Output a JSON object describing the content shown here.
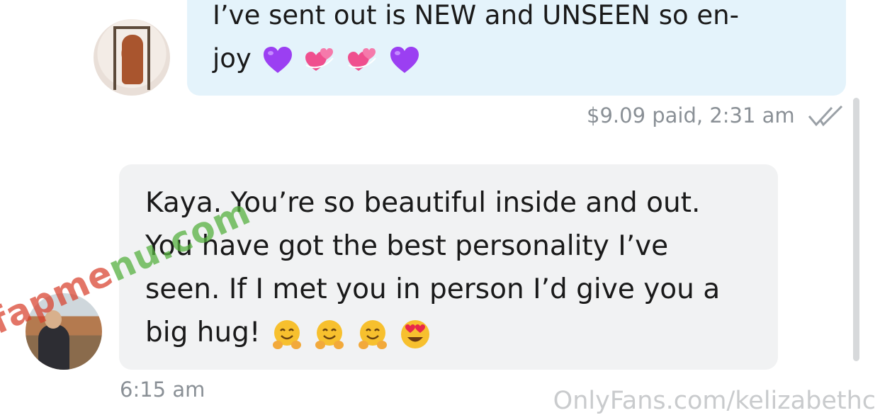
{
  "sent_message": {
    "line_1": "I’ve sent out is NEW and UNSEEN so en-",
    "line_2": "joy",
    "emojis": [
      "purple-heart-icon",
      "revolving-hearts-icon",
      "revolving-hearts-icon",
      "purple-heart-icon"
    ],
    "meta": "$9.09 paid, 2:31 am",
    "status": "read-double-check-icon"
  },
  "received_message": {
    "line_1": "Kaya. You’re so beautiful inside and out.",
    "line_2": "You have got the best personality I’ve",
    "line_3": "seen. If I met you in person I’d give you a",
    "line_4": "big hug!",
    "emojis": [
      "hugging-face-icon",
      "hugging-face-icon",
      "hugging-face-icon",
      "heart-eyes-face-icon"
    ],
    "time": "6:15 am"
  },
  "watermarks": {
    "onlyfans": "OnlyFans.com/kelizabethc",
    "site_part_1": "fapme",
    "site_part_2": "nu.com"
  },
  "colors": {
    "sent_bubble": "#e4f3fb",
    "received_bubble": "#f1f2f3",
    "meta_text": "#8a9096",
    "purple_heart": "#9b3ff2",
    "pink_hearts": "#ef4f8e",
    "emoji_yellow": "#f7c02e"
  }
}
